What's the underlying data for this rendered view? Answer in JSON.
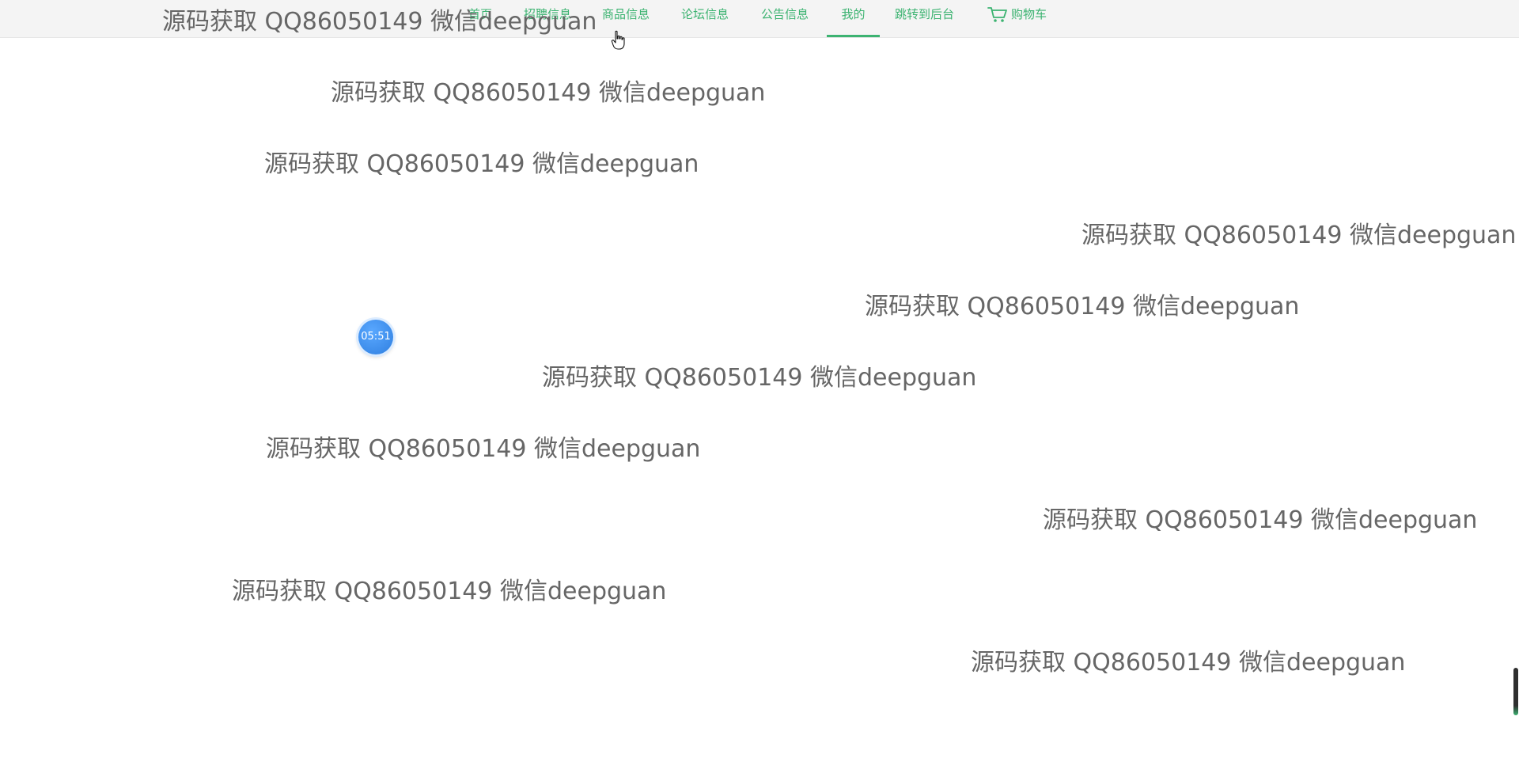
{
  "nav": {
    "items": [
      {
        "label": "首页",
        "active": false
      },
      {
        "label": "招聘信息",
        "active": false
      },
      {
        "label": "商品信息",
        "active": false
      },
      {
        "label": "论坛信息",
        "active": false
      },
      {
        "label": "公告信息",
        "active": false
      },
      {
        "label": "我的",
        "active": true
      },
      {
        "label": "跳转到后台",
        "active": false
      }
    ],
    "cart_label": "购物车",
    "accent_color": "#3cb371"
  },
  "watermark_text": "源码获取 QQ86050149 微信deepguan",
  "timer": {
    "label": "05:51"
  }
}
